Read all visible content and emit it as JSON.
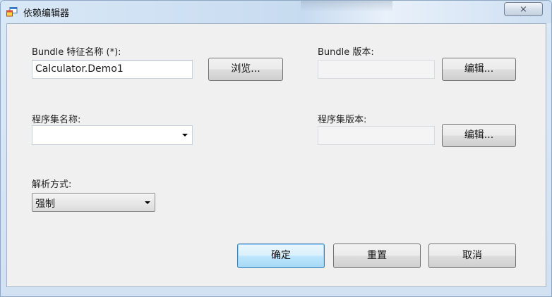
{
  "window": {
    "title": "依赖编辑器",
    "close_glyph": "⨯"
  },
  "form": {
    "bundle_name": {
      "label": "Bundle 特征名称 (*):",
      "value": "Calculator.Demo1",
      "browse_button": "浏览..."
    },
    "bundle_version": {
      "label": "Bundle 版本:",
      "value": "",
      "edit_button": "编辑..."
    },
    "assembly_name": {
      "label": "程序集名称:",
      "value": ""
    },
    "assembly_version": {
      "label": "程序集版本:",
      "value": "",
      "edit_button": "编辑..."
    },
    "resolution": {
      "label": "解析方式:",
      "value": "强制"
    }
  },
  "buttons": {
    "ok": "确定",
    "reset": "重置",
    "cancel": "取消"
  },
  "icons": {
    "app": "app-window-icon",
    "dropdown": "dropdown-arrow-icon"
  },
  "colors": {
    "default_button_border": "#3c7fb1",
    "client_bg": "#f0f0f0"
  }
}
